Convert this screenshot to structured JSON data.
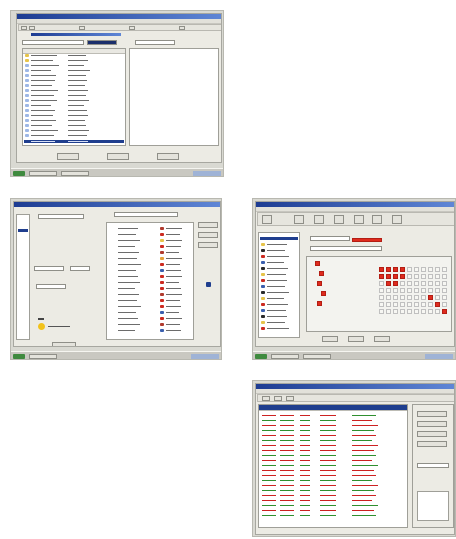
{
  "screenshots": [
    {
      "id": "file-browser"
    },
    {
      "id": "list-editor"
    },
    {
      "id": "grid-editor"
    },
    {
      "id": "log-viewer"
    }
  ],
  "colors": {
    "titlebar": "#1d3c92",
    "selection": "#1f3e8e",
    "marker_red": "#df2b1e",
    "log_red": "#cc2222",
    "log_green": "#2f8f2f"
  }
}
